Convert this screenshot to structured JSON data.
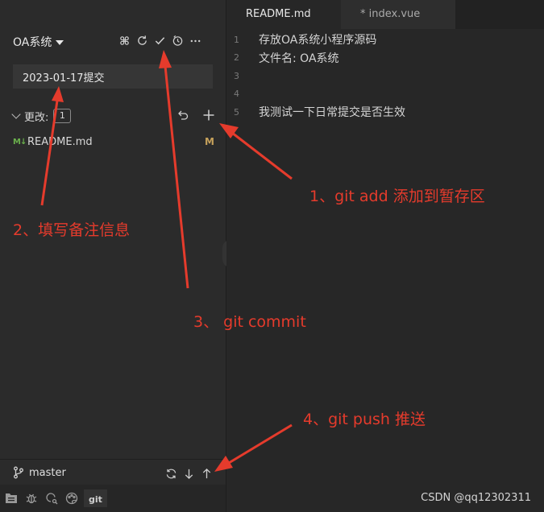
{
  "repo": {
    "title": "OA系统"
  },
  "commit": {
    "message": "2023-01-17提交"
  },
  "changes": {
    "label": "更改:",
    "count": "1",
    "files": [
      {
        "name": "README.md",
        "status": "M",
        "icon": "M↓"
      }
    ]
  },
  "tabs": [
    {
      "label": "README.md"
    },
    {
      "label": "* index.vue"
    }
  ],
  "editor": {
    "lines": [
      {
        "num": "1",
        "text": "存放OA系统小程序源码"
      },
      {
        "num": "2",
        "text": "文件名: OA系统"
      },
      {
        "num": "3",
        "text": ""
      },
      {
        "num": "4",
        "text": ""
      },
      {
        "num": "5",
        "text": "我测试一下日常提交是否生效"
      }
    ]
  },
  "status": {
    "branch": "master"
  },
  "bottom": {
    "git_tab": "git"
  },
  "annotations": {
    "a1": "1、git add 添加到暂存区",
    "a2": "2、填写备注信息",
    "a3": "3、 git commit",
    "a4": "4、git push 推送"
  },
  "watermark": "CSDN @qq12302311",
  "colors": {
    "annotation": "#e53b2c",
    "modified": "#c6a15b",
    "markdown": "#6ab04c"
  }
}
